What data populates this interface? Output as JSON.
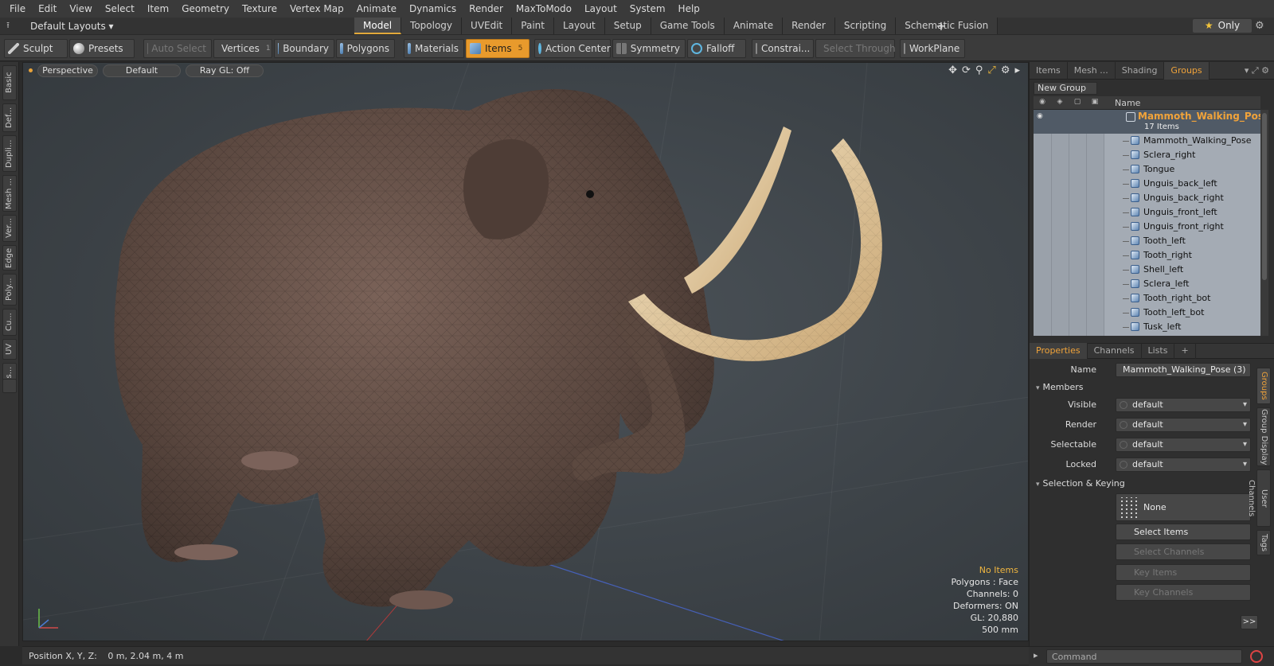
{
  "menu": [
    "File",
    "Edit",
    "View",
    "Select",
    "Item",
    "Geometry",
    "Texture",
    "Vertex Map",
    "Animate",
    "Dynamics",
    "Render",
    "MaxToModo",
    "Layout",
    "System",
    "Help"
  ],
  "layout_select": "Default Layouts ▾",
  "workspace_tabs": [
    {
      "label": "Model",
      "active": true
    },
    {
      "label": "Topology"
    },
    {
      "label": "UVEdit"
    },
    {
      "label": "Paint"
    },
    {
      "label": "Layout"
    },
    {
      "label": "Setup"
    },
    {
      "label": "Game Tools"
    },
    {
      "label": "Animate"
    },
    {
      "label": "Render"
    },
    {
      "label": "Scripting"
    },
    {
      "label": "Schematic Fusion"
    }
  ],
  "plus": "+",
  "only_label": "Only",
  "toolbar": {
    "sculpt": "Sculpt",
    "presets": "Presets",
    "auto_select": "Auto Select",
    "vertices": "Vertices",
    "vertices_count": "1",
    "boundary": "Boundary",
    "polygons": "Polygons",
    "materials": "Materials",
    "items": "Items",
    "items_count": "5",
    "action_center": "Action Center",
    "symmetry": "Symmetry",
    "falloff": "Falloff",
    "constraints": "Constrai...",
    "select_through": "Select Through",
    "workplane": "WorkPlane"
  },
  "left_tabs": [
    "Basic",
    "Def...",
    "Dupli...",
    "Mesh ...",
    "Ver...",
    "Edge",
    "Poly...",
    "Cu...",
    "UV",
    "Fus..."
  ],
  "viewport": {
    "view": "Perspective",
    "shading": "Default",
    "raygl": "Ray GL: Off",
    "info": {
      "no_items": "No Items",
      "polygons": "Polygons : Face",
      "channels": "Channels: 0",
      "deformers": "Deformers: ON",
      "gl": "GL: 20,880",
      "scale": "500 mm"
    }
  },
  "status": {
    "label": "Position X, Y, Z:",
    "value": "0 m, 2.04 m, 4 m"
  },
  "right_tabs": [
    {
      "label": "Items"
    },
    {
      "label": "Mesh ..."
    },
    {
      "label": "Shading"
    },
    {
      "label": "Groups",
      "active": true
    }
  ],
  "new_group": "New Group",
  "grid_header_name": "Name",
  "group": {
    "name": "Mammoth_Walking_Pose",
    "count": "17 Items"
  },
  "group_items": [
    "Mammoth_Walking_Pose",
    "Sclera_right",
    "Tongue",
    "Unguis_back_left",
    "Unguis_back_right",
    "Unguis_front_left",
    "Unguis_front_right",
    "Tooth_left",
    "Tooth_right",
    "Shell_left",
    "Sclera_left",
    "Tooth_right_bot",
    "Tooth_left_bot",
    "Tusk_left"
  ],
  "prop_tabs": [
    {
      "label": "Properties",
      "active": true
    },
    {
      "label": "Channels"
    },
    {
      "label": "Lists"
    },
    {
      "label": "+"
    }
  ],
  "properties": {
    "name_label": "Name",
    "name_value": "Mammoth_Walking_Pose (3)",
    "members": "Members",
    "visible_label": "Visible",
    "visible": "default",
    "render_label": "Render",
    "render": "default",
    "selectable_label": "Selectable",
    "selectable": "default",
    "locked_label": "Locked",
    "locked": "default",
    "sel_keying": "Selection & Keying",
    "none": "None",
    "select_items": "Select Items",
    "select_channels": "Select Channels",
    "key_items": "Key Items",
    "key_channels": "Key Channels",
    "more": ">>"
  },
  "side_vtabs": [
    {
      "label": "Groups",
      "active": true
    },
    {
      "label": "Group Display"
    },
    {
      "label": "User Channels"
    },
    {
      "label": "Tags"
    }
  ],
  "command_placeholder": "Command",
  "colors": {
    "accent": "#e89a2c",
    "selection_text": "#f0a33a",
    "list_bg": "#a4abb4"
  }
}
